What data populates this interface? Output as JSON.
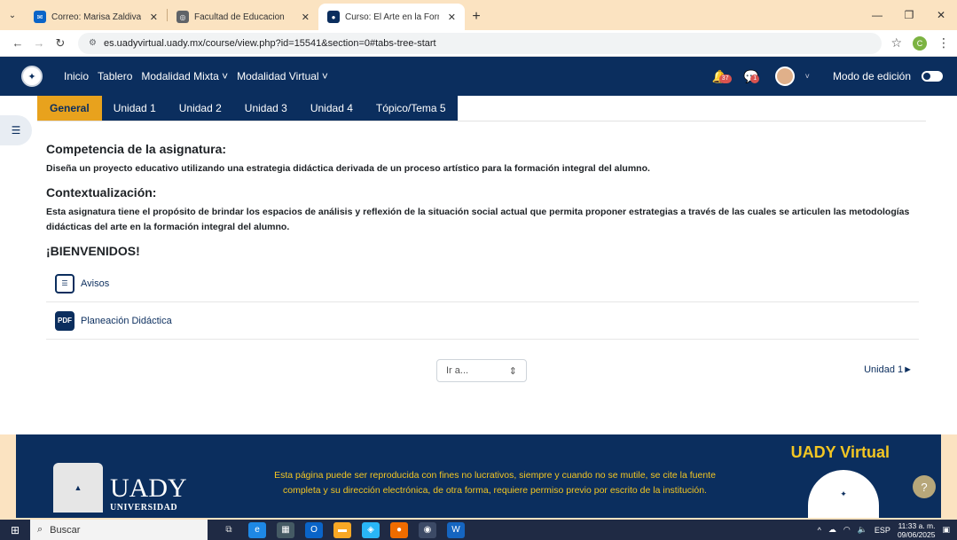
{
  "browser": {
    "tabs": [
      {
        "title": "Correo: Marisa Zaldivar Acosta",
        "active": false
      },
      {
        "title": "Facultad de Educacion",
        "active": false
      },
      {
        "title": "Curso: El Arte en la Formación I",
        "active": true
      }
    ],
    "new_tab": "+",
    "url": "es.uadyvirtual.uady.mx/course/view.php?id=15541&section=0#tabs-tree-start",
    "profile_initial": "C"
  },
  "navbar": {
    "links": [
      "Inicio",
      "Tablero",
      "Modalidad Mixta ˅",
      "Modalidad Virtual ˅"
    ],
    "notifications_count": "37",
    "messages_count": "1",
    "edit_mode_label": "Modo de edición"
  },
  "course_tabs": [
    "General",
    "Unidad 1",
    "Unidad 2",
    "Unidad 3",
    "Unidad 4",
    "Tópico/Tema 5"
  ],
  "content": {
    "competencia_title": "Competencia de la asignatura:",
    "competencia_text": "Diseña un proyecto educativo utilizando una estrategia didáctica derivada de un proceso artístico para la formación integral del alumno.",
    "contexto_title": "Contextualización:",
    "contexto_text": "Esta asignatura tiene el propósito de brindar los espacios de análisis y reflexión de la situación social actual que permita proponer estrategias a través de las cuales se articulen las metodologías didácticas del arte en la formación integral del alumno.",
    "welcome": "¡BIENVENIDOS!",
    "activities": [
      {
        "name": "Avisos",
        "icon": "forum-icon"
      },
      {
        "name": "Planeación Didáctica",
        "icon": "pdf-icon"
      }
    ],
    "goto_label": "Ir a...",
    "next_unit": "Unidad 1►"
  },
  "footer": {
    "uady_big": "UADY",
    "uady_small": "UNIVERSIDAD",
    "notice": "Esta página puede ser reproducida con fines no lucrativos, siempre y cuando no se mutile, se cite la fuente completa y su dirección electrónica, de otra forma, requiere permiso previo por escrito de la institución.",
    "brand": "UADY Virtual",
    "help": "?"
  },
  "taskbar": {
    "search_placeholder": "Buscar",
    "lang": "ESP",
    "time": "11:33 a. m.",
    "date": "09/06/2025"
  }
}
